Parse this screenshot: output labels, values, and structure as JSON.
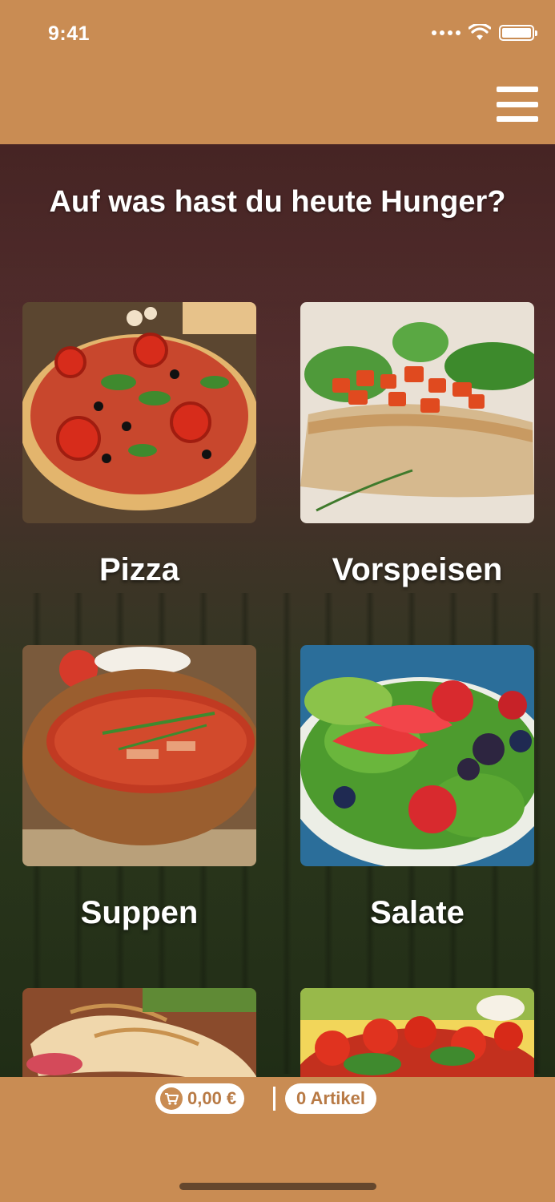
{
  "status_bar": {
    "time": "9:41"
  },
  "header": {
    "menu_icon": "hamburger-menu-icon"
  },
  "main": {
    "headline": "Auf was hast du heute Hunger?",
    "categories": [
      {
        "label": "Pizza"
      },
      {
        "label": "Vorspeisen"
      },
      {
        "label": "Suppen"
      },
      {
        "label": "Salate"
      },
      {
        "label": ""
      },
      {
        "label": ""
      }
    ]
  },
  "footer": {
    "cart_total": "0,00 €",
    "item_count": "0 Artikel",
    "cart_icon": "shopping-cart-icon"
  },
  "colors": {
    "brand": "#c98c53",
    "pill_text": "#b87a45"
  }
}
